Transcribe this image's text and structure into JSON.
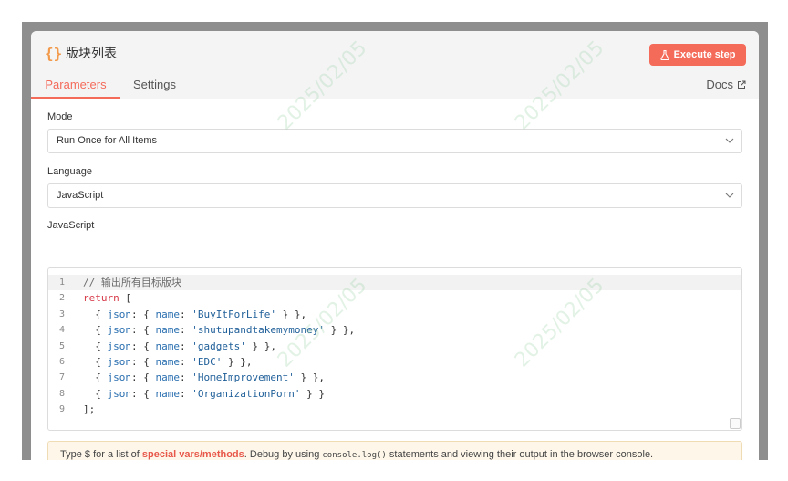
{
  "node": {
    "icon": "{}",
    "title": "版块列表",
    "execute_label": "Execute step"
  },
  "tabs": [
    {
      "label": "Parameters",
      "active": true
    },
    {
      "label": "Settings",
      "active": false
    }
  ],
  "docs_label": "Docs",
  "mode": {
    "label": "Mode",
    "value": "Run Once for All Items"
  },
  "language": {
    "label": "Language",
    "value": "JavaScript"
  },
  "code_section": {
    "label": "JavaScript",
    "lines": [
      {
        "n": "1",
        "text": "// 输出所有目标版块"
      },
      {
        "n": "2",
        "text": "return ["
      },
      {
        "n": "3",
        "text": "  { json: { name: 'BuyItForLife' } },"
      },
      {
        "n": "4",
        "text": "  { json: { name: 'shutupandtakemymoney' } },"
      },
      {
        "n": "5",
        "text": "  { json: { name: 'gadgets' } },"
      },
      {
        "n": "6",
        "text": "  { json: { name: 'EDC' } },"
      },
      {
        "n": "7",
        "text": "  { json: { name: 'HomeImprovement' } },"
      },
      {
        "n": "8",
        "text": "  { json: { name: 'OrganizationPorn' } }"
      },
      {
        "n": "9",
        "text": "];"
      }
    ]
  },
  "hint": {
    "prefix": "Type $ for a list of ",
    "link": "special vars/methods",
    "middle": ". Debug by using ",
    "code": "console.log()",
    "suffix": " statements and viewing their output in the browser console."
  },
  "watermark": "2025/02/05",
  "colors": {
    "accent": "#f46b5a",
    "icon": "#f2994a",
    "hint_bg": "#fdf6e9"
  }
}
